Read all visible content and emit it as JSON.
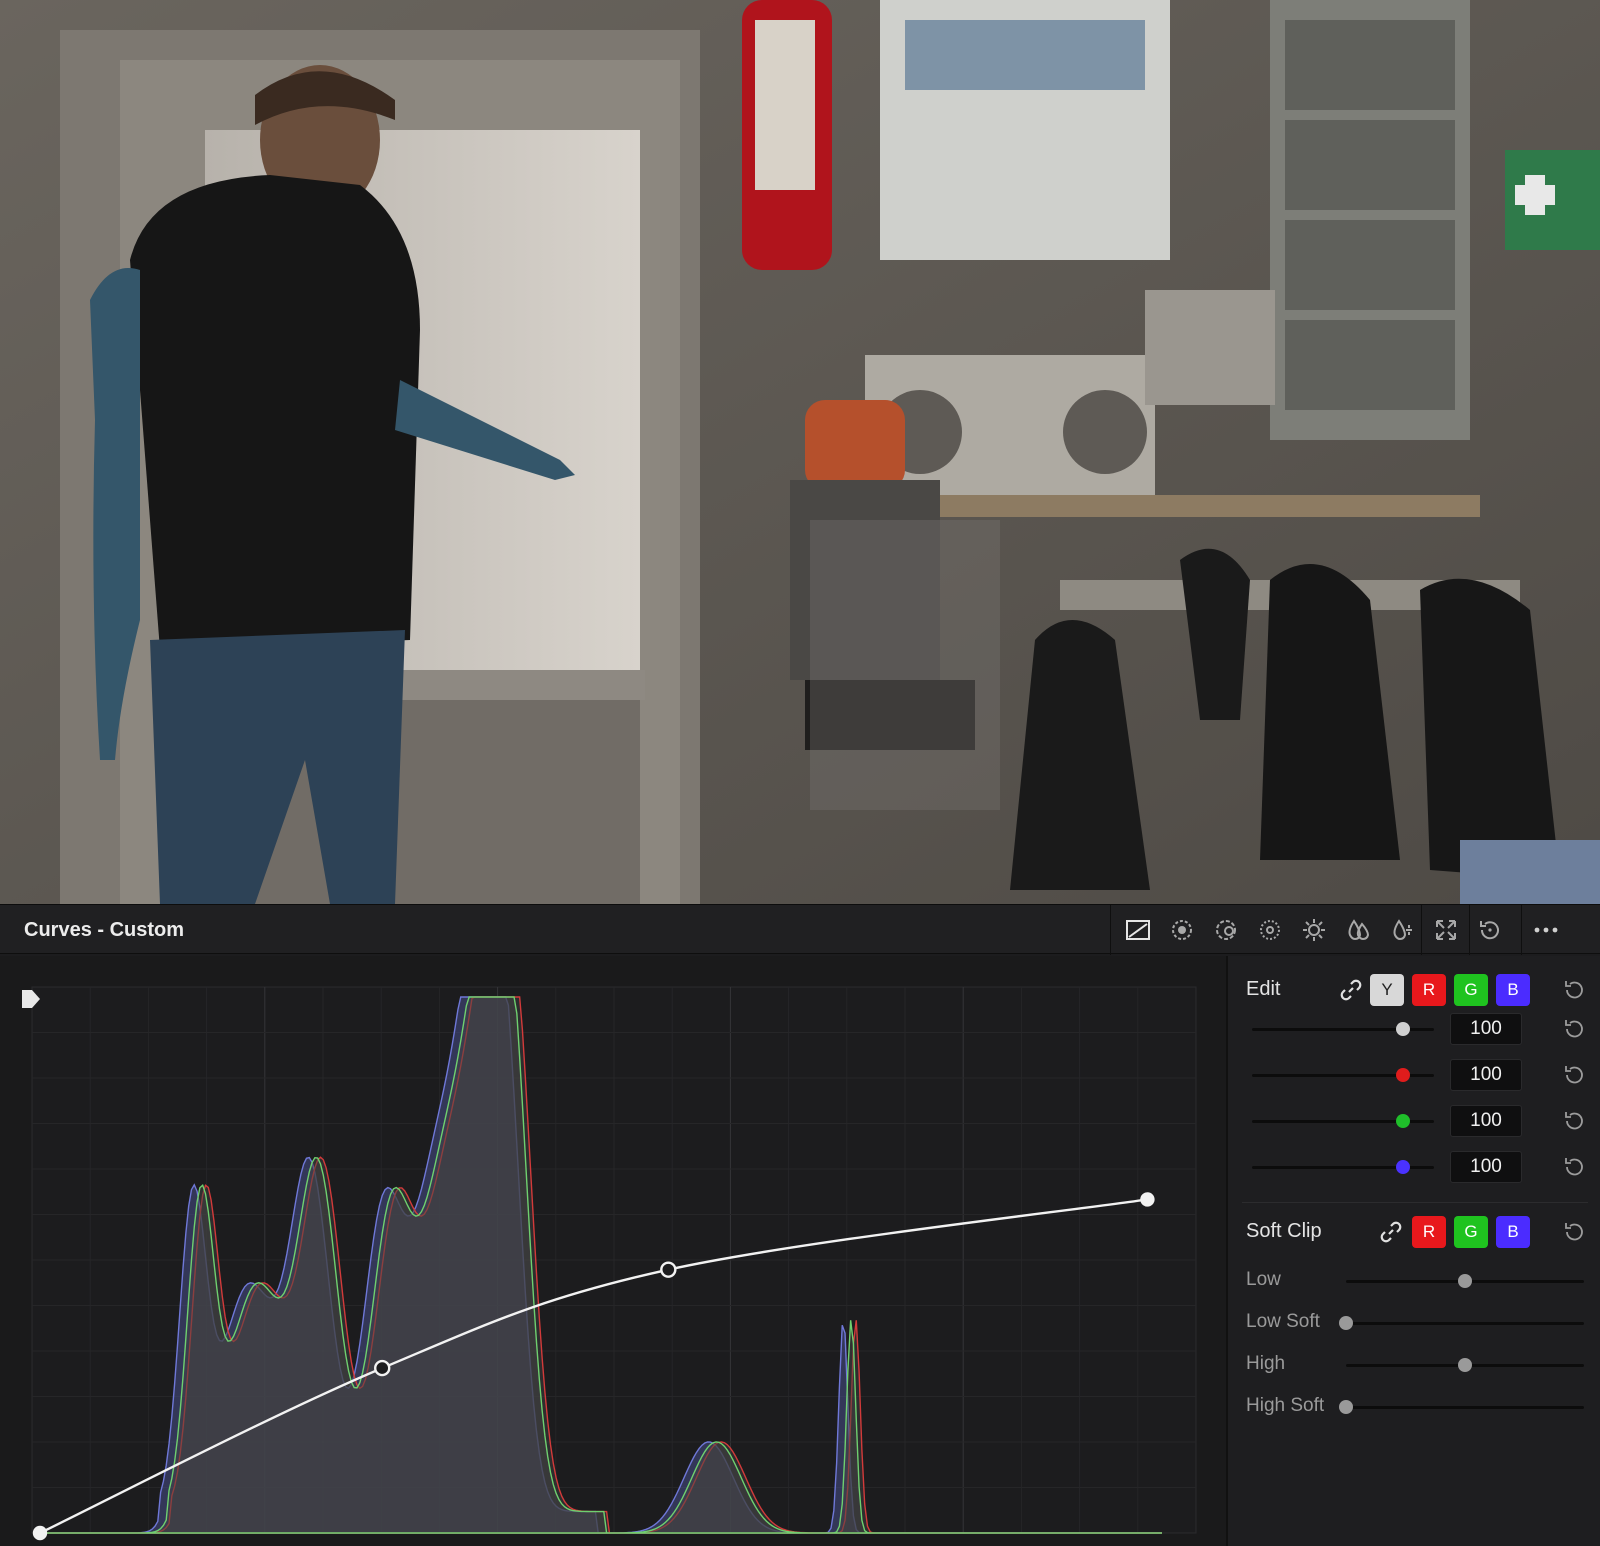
{
  "panel": {
    "title": "Curves - Custom"
  },
  "toolbar": {
    "items": [
      {
        "name": "curves-custom-icon",
        "active": true
      },
      {
        "name": "hue-vs-hue-icon"
      },
      {
        "name": "hue-vs-sat-icon"
      },
      {
        "name": "hue-vs-lum-icon"
      },
      {
        "name": "lum-vs-sat-icon"
      },
      {
        "name": "sat-vs-sat-icon"
      },
      {
        "name": "sat-vs-lum-icon"
      },
      {
        "name": "expand-icon"
      },
      {
        "name": "reset-icon"
      },
      {
        "name": "more-options-icon"
      }
    ]
  },
  "edit": {
    "label": "Edit",
    "channels": [
      "Y",
      "R",
      "G",
      "B"
    ],
    "sliders": [
      {
        "channel": "Y",
        "value": "100",
        "color": "#d0d0d0"
      },
      {
        "channel": "R",
        "value": "100",
        "color": "#e01c1c"
      },
      {
        "channel": "G",
        "value": "100",
        "color": "#1fbf2a"
      },
      {
        "channel": "B",
        "value": "100",
        "color": "#4a32ff"
      }
    ]
  },
  "soft_clip": {
    "label": "Soft Clip",
    "channels": [
      "R",
      "G",
      "B"
    ],
    "rows": [
      {
        "label": "Low",
        "value": 0.5
      },
      {
        "label": "Low Soft",
        "value": 0.0
      },
      {
        "label": "High",
        "value": 0.5
      },
      {
        "label": "High Soft",
        "value": 0.0
      }
    ]
  },
  "curve": {
    "points": [
      [
        0.0,
        0.0
      ],
      [
        0.305,
        0.31
      ],
      [
        0.56,
        0.495
      ],
      [
        0.987,
        0.627
      ]
    ],
    "colors": {
      "y": "#f2f2f2",
      "r": "#d23a3a",
      "g": "#6fd06f",
      "b": "#6f78d8"
    }
  }
}
